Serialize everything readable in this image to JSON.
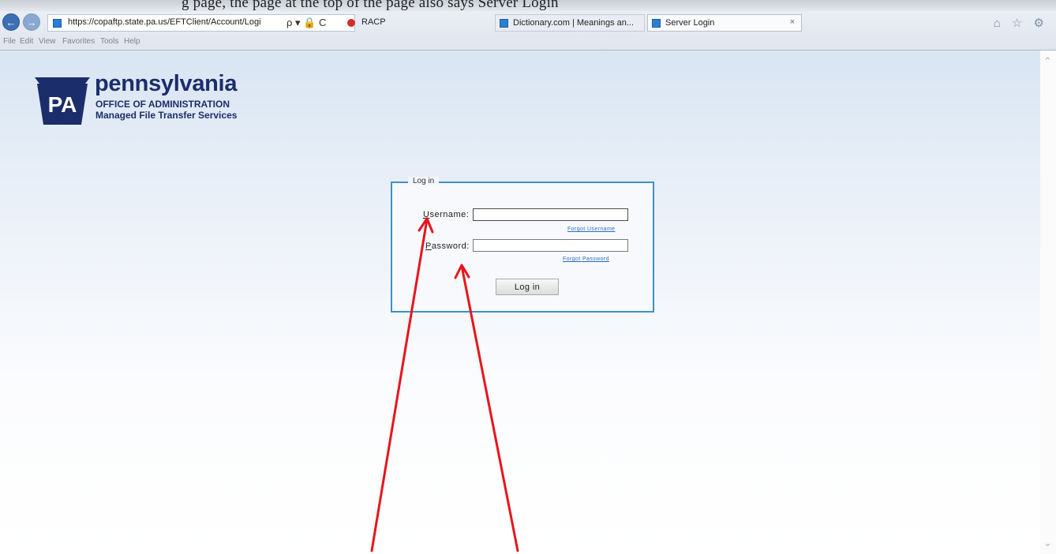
{
  "browser": {
    "top_clip_text": "g page, the page at the top of the page also says Server Login",
    "address": {
      "url": "https://copaftp.state.pa.us/EFTClient/Account/Logi",
      "icons": "ρ ▾ 🔒 C"
    },
    "tabs": [
      {
        "label": "RACP"
      },
      {
        "label": "Dictionary.com | Meanings an..."
      },
      {
        "label": "Server Login",
        "close": "×"
      }
    ],
    "right_icons": "⌂ ☆ ⚙",
    "menu": [
      "File",
      "Edit",
      "View",
      "Favorites",
      "Tools",
      "Help"
    ]
  },
  "logo": {
    "badge_text": "PA",
    "main": "pennsylvania",
    "sub1": "OFFICE OF ADMINISTRATION",
    "sub2": "Managed File Transfer Services"
  },
  "login": {
    "legend": "Log in",
    "username_label_first": "U",
    "username_label_rest": "sername:",
    "username_value": "",
    "forgot_username": "Forgot Username",
    "password_label_first": "P",
    "password_label_rest": "assword:",
    "password_value": "",
    "forgot_password": "Forgot Password",
    "button": "Log in"
  },
  "colors": {
    "annotation_arrow": "#e8141c",
    "fieldset_border": "#3b93c4",
    "brand_navy": "#1c2d6b",
    "link": "#2b6fc0"
  },
  "icons": {
    "back": "back-arrow-icon",
    "forward": "forward-arrow-icon",
    "home": "home-icon",
    "favorites": "star-icon",
    "settings": "gear-icon",
    "scroll_up": "chevron-up-icon",
    "scroll_down": "chevron-down-icon"
  }
}
